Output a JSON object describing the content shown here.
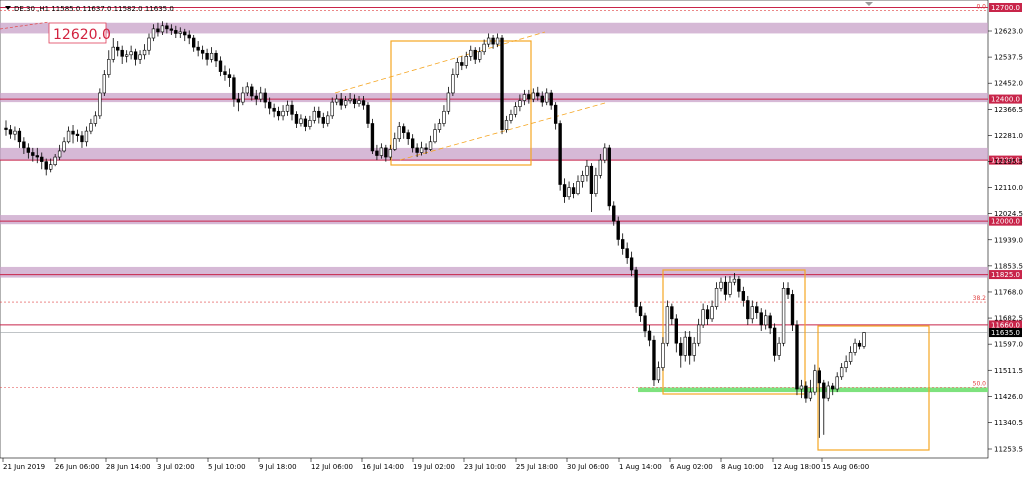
{
  "header": {
    "symbol_text": "DE.30 ,H1  11585.0  11637.0  11582.0  11635.0",
    "arrow_icon": "triangle-down-icon"
  },
  "annotations": {
    "big_label": "12620.0"
  },
  "colors": {
    "zone_fill": "#c8a2c8",
    "level_line": "#c8254a",
    "orange_box": "#f5a623",
    "green_zone": "#7ee27e",
    "bull_candle": "#ffffff",
    "bear_candle": "#000000",
    "fib_line": "#e04040"
  },
  "chart_data": {
    "type": "candlestick",
    "title": "",
    "ylim": [
      11220,
      12750
    ],
    "y_ticks": [
      "12623.0",
      "12537.5",
      "12452.0",
      "12366.5",
      "12281.0",
      "12195.5",
      "12110.0",
      "12024.5",
      "11939.0",
      "11853.5",
      "11768.0",
      "11682.5",
      "11597.0",
      "11511.5",
      "11426.0",
      "11340.5",
      "11253.5"
    ],
    "y_tick_values": [
      12623.0,
      12537.5,
      12452.0,
      12366.5,
      12281.0,
      12195.5,
      12110.0,
      12024.5,
      11939.0,
      11853.5,
      11768.0,
      11682.5,
      11597.0,
      11511.5,
      11426.0,
      11340.5,
      11253.5
    ],
    "x_ticks": [
      "21 Jun 2019",
      "26 Jun 06:00",
      "28 Jun 14:00",
      "3 Jul 02:00",
      "5 Jul 10:00",
      "9 Jul 18:00",
      "12 Jul 06:00",
      "16 Jul 14:00",
      "19 Jul 02:00",
      "23 Jul 10:00",
      "25 Jul 18:00",
      "30 Jul 06:00",
      "1 Aug 14:00",
      "6 Aug 02:00",
      "8 Aug 10:00",
      "12 Aug 18:00",
      "15 Aug 06:00"
    ],
    "levels": [
      {
        "value": 12700.0,
        "label": "12700.0"
      },
      {
        "value": 12400.0,
        "label": "12400.0"
      },
      {
        "value": 12200.0,
        "label": "12200.0"
      },
      {
        "value": 12000.0,
        "label": "12000.0"
      },
      {
        "value": 11825.0,
        "label": "11825.0"
      },
      {
        "value": 11660.0,
        "label": "11660.0"
      }
    ],
    "current_price": {
      "value": 11635.0,
      "label": "11635.0"
    },
    "zones": [
      {
        "from": 12615,
        "to": 12650
      },
      {
        "from": 12390,
        "to": 12420
      },
      {
        "from": 12200,
        "to": 12240
      },
      {
        "from": 11990,
        "to": 12020
      },
      {
        "from": 11815,
        "to": 11850
      }
    ],
    "fib_levels": [
      {
        "value": 12690,
        "label": "0.0"
      },
      {
        "value": 11735,
        "label": "38.2"
      },
      {
        "value": 11455,
        "label": "50.0"
      }
    ],
    "green_zone": {
      "from": 11440,
      "to": 11455
    },
    "candles": [
      [
        12305,
        12300,
        12330,
        12280
      ],
      [
        12300,
        12285,
        12315,
        12270
      ],
      [
        12285,
        12295,
        12310,
        12265
      ],
      [
        12295,
        12260,
        12305,
        12240
      ],
      [
        12260,
        12240,
        12275,
        12220
      ],
      [
        12240,
        12225,
        12255,
        12205
      ],
      [
        12225,
        12215,
        12240,
        12195
      ],
      [
        12215,
        12210,
        12240,
        12190
      ],
      [
        12210,
        12195,
        12225,
        12170
      ],
      [
        12195,
        12170,
        12205,
        12150
      ],
      [
        12170,
        12185,
        12205,
        12160
      ],
      [
        12185,
        12210,
        12220,
        12180
      ],
      [
        12210,
        12230,
        12250,
        12200
      ],
      [
        12230,
        12260,
        12275,
        12225
      ],
      [
        12260,
        12295,
        12310,
        12255
      ],
      [
        12295,
        12285,
        12315,
        12255
      ],
      [
        12285,
        12280,
        12300,
        12260
      ],
      [
        12280,
        12260,
        12295,
        12240
      ],
      [
        12260,
        12295,
        12310,
        12245
      ],
      [
        12295,
        12320,
        12335,
        12285
      ],
      [
        12320,
        12345,
        12360,
        12310
      ],
      [
        12345,
        12420,
        12435,
        12335
      ],
      [
        12420,
        12480,
        12495,
        12410
      ],
      [
        12480,
        12530,
        12560,
        12470
      ],
      [
        12530,
        12570,
        12600,
        12520
      ],
      [
        12570,
        12560,
        12590,
        12540
      ],
      [
        12560,
        12540,
        12575,
        12515
      ],
      [
        12540,
        12545,
        12560,
        12520
      ],
      [
        12545,
        12555,
        12575,
        12530
      ],
      [
        12555,
        12530,
        12565,
        12510
      ],
      [
        12530,
        12545,
        12560,
        12515
      ],
      [
        12545,
        12560,
        12580,
        12530
      ],
      [
        12560,
        12600,
        12615,
        12545
      ],
      [
        12600,
        12630,
        12645,
        12590
      ],
      [
        12630,
        12620,
        12650,
        12605
      ],
      [
        12620,
        12640,
        12655,
        12610
      ],
      [
        12640,
        12630,
        12650,
        12615
      ],
      [
        12630,
        12625,
        12645,
        12610
      ],
      [
        12625,
        12615,
        12640,
        12600
      ],
      [
        12615,
        12620,
        12635,
        12600
      ],
      [
        12620,
        12610,
        12630,
        12590
      ],
      [
        12610,
        12600,
        12625,
        12580
      ],
      [
        12600,
        12570,
        12610,
        12555
      ],
      [
        12570,
        12560,
        12590,
        12540
      ],
      [
        12560,
        12550,
        12575,
        12530
      ],
      [
        12550,
        12530,
        12565,
        12510
      ],
      [
        12530,
        12550,
        12570,
        12520
      ],
      [
        12550,
        12525,
        12560,
        12505
      ],
      [
        12525,
        12490,
        12540,
        12475
      ],
      [
        12490,
        12480,
        12510,
        12460
      ],
      [
        12480,
        12470,
        12500,
        12440
      ],
      [
        12470,
        12400,
        12480,
        12375
      ],
      [
        12400,
        12390,
        12420,
        12360
      ],
      [
        12390,
        12420,
        12440,
        12380
      ],
      [
        12420,
        12440,
        12455,
        12410
      ],
      [
        12440,
        12410,
        12450,
        12395
      ],
      [
        12410,
        12400,
        12430,
        12380
      ],
      [
        12400,
        12420,
        12440,
        12390
      ],
      [
        12420,
        12390,
        12435,
        12370
      ],
      [
        12390,
        12370,
        12405,
        12350
      ],
      [
        12370,
        12360,
        12385,
        12340
      ],
      [
        12360,
        12345,
        12375,
        12330
      ],
      [
        12345,
        12360,
        12380,
        12330
      ],
      [
        12360,
        12380,
        12395,
        12345
      ],
      [
        12380,
        12350,
        12395,
        12330
      ],
      [
        12350,
        12320,
        12360,
        12305
      ],
      [
        12320,
        12335,
        12350,
        12310
      ],
      [
        12335,
        12310,
        12345,
        12295
      ],
      [
        12310,
        12330,
        12345,
        12300
      ],
      [
        12330,
        12360,
        12375,
        12320
      ],
      [
        12360,
        12340,
        12375,
        12320
      ],
      [
        12340,
        12320,
        12355,
        12305
      ],
      [
        12320,
        12345,
        12360,
        12310
      ],
      [
        12345,
        12390,
        12405,
        12335
      ],
      [
        12390,
        12400,
        12415,
        12380
      ],
      [
        12400,
        12380,
        12420,
        12365
      ],
      [
        12380,
        12395,
        12410,
        12370
      ],
      [
        12395,
        12400,
        12420,
        12385
      ],
      [
        12400,
        12385,
        12415,
        12370
      ],
      [
        12385,
        12395,
        12410,
        12375
      ],
      [
        12395,
        12380,
        12410,
        12365
      ],
      [
        12380,
        12320,
        12390,
        12305
      ],
      [
        12320,
        12230,
        12335,
        12220
      ],
      [
        12230,
        12215,
        12250,
        12200
      ],
      [
        12215,
        12240,
        12255,
        12205
      ],
      [
        12240,
        12210,
        12250,
        12195
      ],
      [
        12210,
        12235,
        12250,
        12200
      ],
      [
        12235,
        12270,
        12290,
        12230
      ],
      [
        12270,
        12310,
        12325,
        12260
      ],
      [
        12310,
        12290,
        12320,
        12270
      ],
      [
        12290,
        12270,
        12300,
        12250
      ],
      [
        12270,
        12240,
        12285,
        12225
      ],
      [
        12240,
        12225,
        12255,
        12210
      ],
      [
        12225,
        12240,
        12260,
        12215
      ],
      [
        12240,
        12235,
        12255,
        12220
      ],
      [
        12235,
        12260,
        12280,
        12230
      ],
      [
        12260,
        12300,
        12320,
        12255
      ],
      [
        12300,
        12320,
        12335,
        12290
      ],
      [
        12320,
        12360,
        12380,
        12310
      ],
      [
        12360,
        12420,
        12440,
        12350
      ],
      [
        12420,
        12480,
        12500,
        12410
      ],
      [
        12480,
        12520,
        12535,
        12470
      ],
      [
        12520,
        12510,
        12540,
        12495
      ],
      [
        12510,
        12540,
        12555,
        12500
      ],
      [
        12540,
        12560,
        12575,
        12525
      ],
      [
        12560,
        12530,
        12570,
        12515
      ],
      [
        12530,
        12555,
        12570,
        12520
      ],
      [
        12555,
        12580,
        12595,
        12545
      ],
      [
        12580,
        12600,
        12615,
        12570
      ],
      [
        12600,
        12580,
        12610,
        12565
      ],
      [
        12580,
        12600,
        12615,
        12570
      ],
      [
        12600,
        12300,
        12610,
        12285
      ],
      [
        12300,
        12330,
        12345,
        12290
      ],
      [
        12330,
        12350,
        12365,
        12320
      ],
      [
        12350,
        12375,
        12390,
        12340
      ],
      [
        12375,
        12395,
        12415,
        12360
      ],
      [
        12395,
        12415,
        12430,
        12380
      ],
      [
        12415,
        12400,
        12430,
        12385
      ],
      [
        12400,
        12420,
        12435,
        12390
      ],
      [
        12420,
        12410,
        12440,
        12395
      ],
      [
        12410,
        12390,
        12425,
        12375
      ],
      [
        12390,
        12420,
        12435,
        12380
      ],
      [
        12420,
        12380,
        12430,
        12365
      ],
      [
        12380,
        12320,
        12390,
        12300
      ],
      [
        12320,
        12120,
        12330,
        12100
      ],
      [
        12120,
        12080,
        12140,
        12060
      ],
      [
        12080,
        12110,
        12130,
        12070
      ],
      [
        12110,
        12090,
        12125,
        12075
      ],
      [
        12090,
        12130,
        12150,
        12085
      ],
      [
        12130,
        12150,
        12165,
        12110
      ],
      [
        12150,
        12180,
        12200,
        12130
      ],
      [
        12180,
        12090,
        12190,
        12030
      ],
      [
        12090,
        12150,
        12175,
        12080
      ],
      [
        12150,
        12200,
        12220,
        12140
      ],
      [
        12200,
        12240,
        12255,
        12190
      ],
      [
        12240,
        12050,
        12250,
        12035
      ],
      [
        12050,
        12000,
        12065,
        11985
      ],
      [
        12000,
        11940,
        12015,
        11920
      ],
      [
        11940,
        11910,
        11960,
        11890
      ],
      [
        11910,
        11880,
        11930,
        11860
      ],
      [
        11880,
        11840,
        11900,
        11820
      ],
      [
        11840,
        11720,
        11850,
        11700
      ],
      [
        11720,
        11690,
        11735,
        11670
      ],
      [
        11690,
        11640,
        11700,
        11620
      ],
      [
        11640,
        11610,
        11660,
        11590
      ],
      [
        11610,
        11480,
        11625,
        11460
      ],
      [
        11480,
        11520,
        11540,
        11470
      ],
      [
        11520,
        11600,
        11620,
        11510
      ],
      [
        11600,
        11720,
        11740,
        11590
      ],
      [
        11720,
        11680,
        11730,
        11660
      ],
      [
        11680,
        11600,
        11695,
        11570
      ],
      [
        11600,
        11560,
        11620,
        11520
      ],
      [
        11560,
        11620,
        11640,
        11540
      ],
      [
        11620,
        11560,
        11640,
        11530
      ],
      [
        11560,
        11600,
        11620,
        11540
      ],
      [
        11600,
        11660,
        11680,
        11590
      ],
      [
        11660,
        11710,
        11730,
        11650
      ],
      [
        11710,
        11680,
        11725,
        11660
      ],
      [
        11680,
        11720,
        11740,
        11670
      ],
      [
        11720,
        11780,
        11800,
        11710
      ],
      [
        11780,
        11800,
        11815,
        11770
      ],
      [
        11800,
        11760,
        11820,
        11740
      ],
      [
        11760,
        11800,
        11820,
        11750
      ],
      [
        11800,
        11810,
        11830,
        11790
      ],
      [
        11810,
        11770,
        11820,
        11750
      ],
      [
        11770,
        11740,
        11785,
        11720
      ],
      [
        11740,
        11680,
        11755,
        11660
      ],
      [
        11680,
        11720,
        11740,
        11665
      ],
      [
        11720,
        11700,
        11735,
        11680
      ],
      [
        11700,
        11660,
        11715,
        11640
      ],
      [
        11660,
        11690,
        11710,
        11645
      ],
      [
        11690,
        11650,
        11700,
        11630
      ],
      [
        11650,
        11560,
        11665,
        11540
      ],
      [
        11560,
        11600,
        11620,
        11545
      ],
      [
        11600,
        11780,
        11800,
        11590
      ],
      [
        11780,
        11760,
        11800,
        11745
      ],
      [
        11760,
        11660,
        11775,
        11640
      ],
      [
        11660,
        11450,
        11675,
        11430
      ],
      [
        11450,
        11460,
        11480,
        11420
      ],
      [
        11460,
        11420,
        11475,
        11405
      ],
      [
        11420,
        11440,
        11480,
        11410
      ],
      [
        11440,
        11510,
        11530,
        11430
      ],
      [
        11510,
        11470,
        11520,
        11290
      ],
      [
        11470,
        11420,
        11480,
        11300
      ],
      [
        11420,
        11460,
        11475,
        11410
      ],
      [
        11460,
        11450,
        11470,
        11430
      ],
      [
        11450,
        11490,
        11505,
        11440
      ],
      [
        11490,
        11520,
        11535,
        11480
      ],
      [
        11520,
        11540,
        11560,
        11505
      ],
      [
        11540,
        11570,
        11590,
        11530
      ],
      [
        11570,
        11600,
        11615,
        11560
      ],
      [
        11600,
        11590,
        11610,
        11580
      ],
      [
        11590,
        11635,
        11637,
        11582
      ]
    ]
  }
}
